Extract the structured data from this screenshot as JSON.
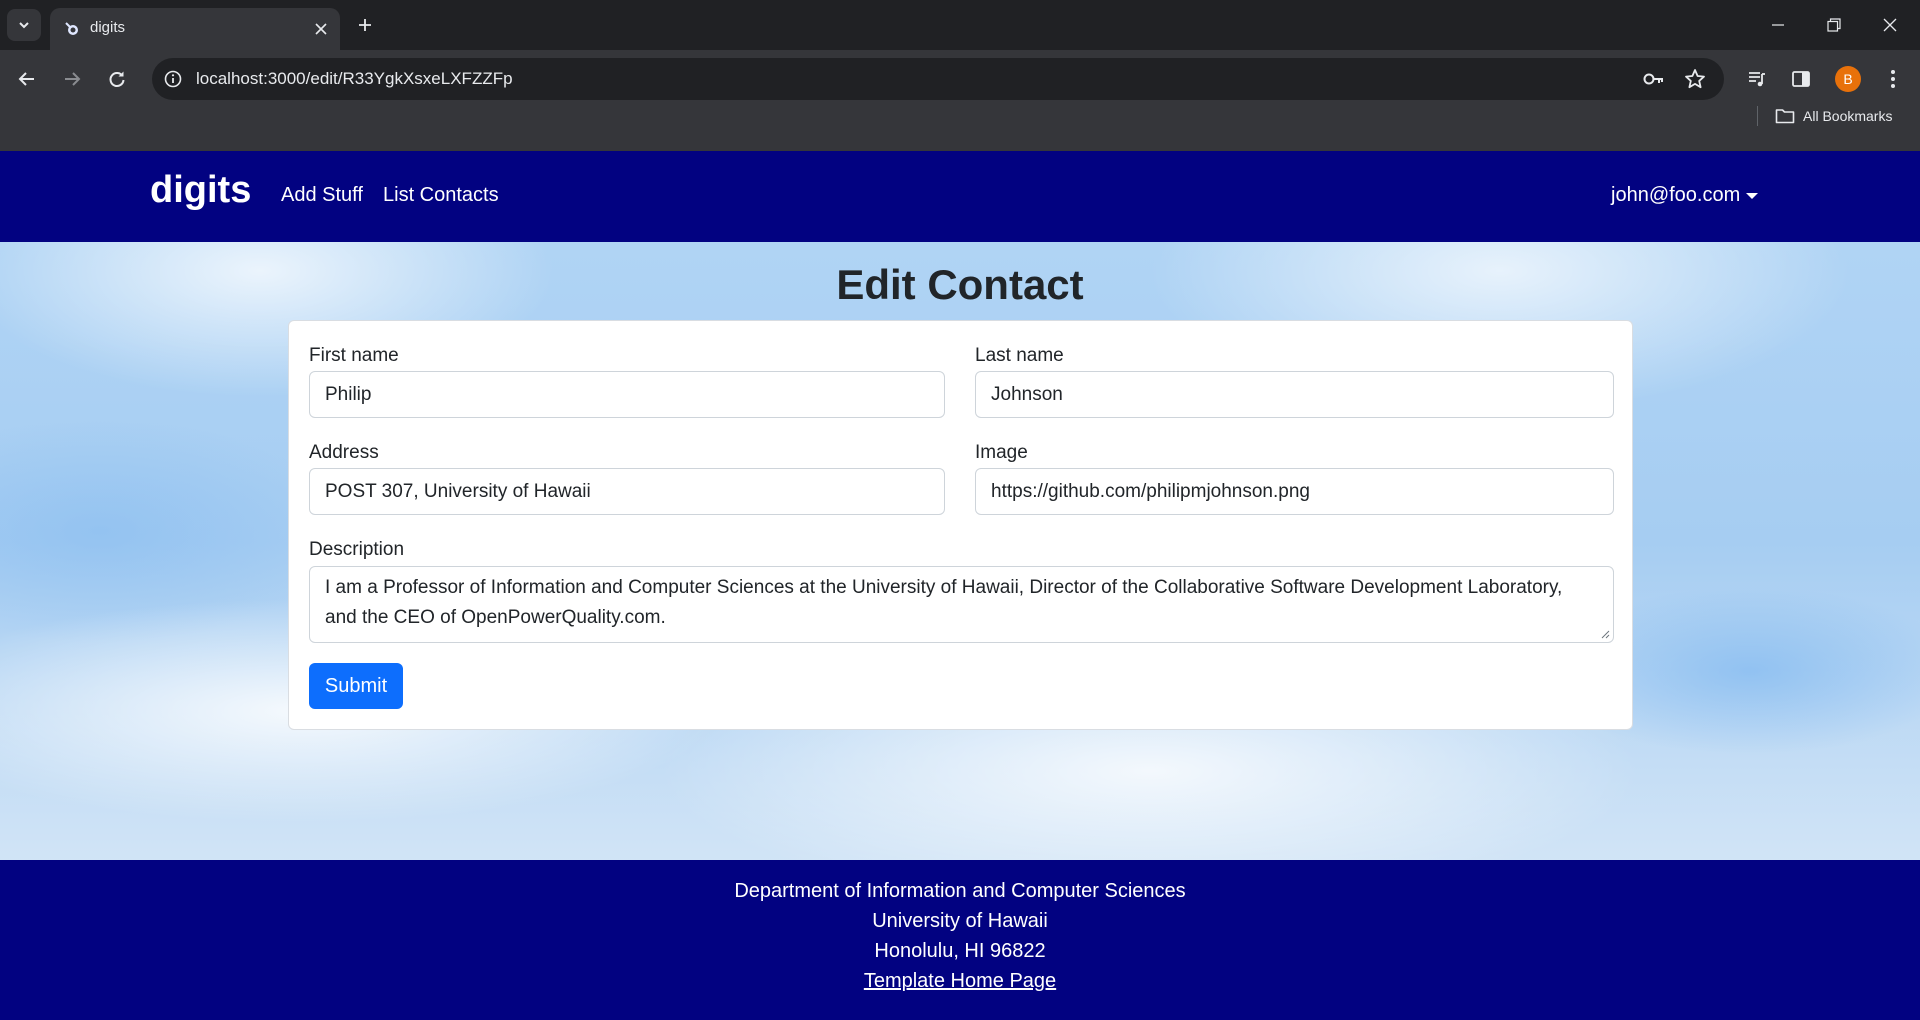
{
  "browser": {
    "tab_title": "digits",
    "url": "localhost:3000/edit/R33YgkXsxeLXFZZFp",
    "profile_initial": "B",
    "bookmarks_label": "All Bookmarks"
  },
  "navbar": {
    "brand": "digits",
    "links": [
      "Add Stuff",
      "List Contacts"
    ],
    "user": "john@foo.com"
  },
  "page": {
    "title": "Edit Contact"
  },
  "form": {
    "first_name_label": "First name",
    "first_name_value": "Philip",
    "last_name_label": "Last name",
    "last_name_value": "Johnson",
    "address_label": "Address",
    "address_value": "POST 307, University of Hawaii",
    "image_label": "Image",
    "image_value": "https://github.com/philipmjohnson.png",
    "description_label": "Description",
    "description_value": "I am a Professor of Information and Computer Sciences at the University of Hawaii, Director of the Collaborative Software Development Laboratory, and the CEO of OpenPowerQuality.com.",
    "submit_label": "Submit"
  },
  "footer": {
    "line1": "Department of Information and Computer Sciences",
    "line2": "University of Hawaii",
    "line3": "Honolulu, HI 96822",
    "link": "Template Home Page"
  },
  "colors": {
    "navbar_bg": "#020281",
    "primary": "#0d6efd",
    "profile_bg": "#e8710a"
  },
  "icons": {
    "tab_list": "chevron-down-icon",
    "favicon": "meteor-favicon-icon",
    "close": "close-icon",
    "new_tab": "plus-icon",
    "back": "arrow-left-icon",
    "forward": "arrow-right-icon",
    "reload": "reload-icon",
    "site_info": "info-icon",
    "password": "key-icon",
    "bookmark": "star-icon",
    "media": "media-queue-icon",
    "side_panel": "side-panel-icon",
    "menu": "kebab-menu-icon",
    "folder": "folder-icon"
  }
}
